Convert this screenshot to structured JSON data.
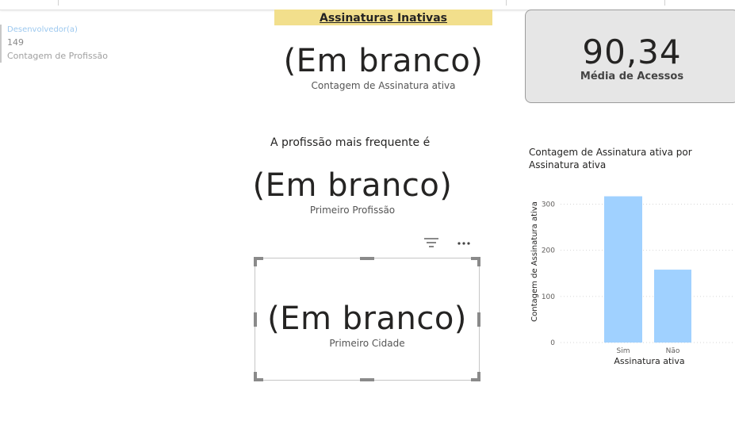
{
  "multirow_card": {
    "title": "Desenvolvedor(a)",
    "value": "149",
    "label": "Contagem de Profissão"
  },
  "banner": {
    "title": "Assinaturas Inativas"
  },
  "card_top": {
    "value": "(Em branco)",
    "caption": "Contagem de Assinatura ativa"
  },
  "kpi": {
    "value": "90,34",
    "caption": "Média de Acessos"
  },
  "headline": "A profissão mais frequente é",
  "card_middle": {
    "value": "(Em branco)",
    "caption": "Primeiro Profissão"
  },
  "card_selected": {
    "value": "(Em branco)",
    "caption": "Primeiro Cidade"
  },
  "visual_header": {
    "filter_icon": "filter-icon",
    "more_icon": "more-options-icon"
  },
  "chart_data": {
    "type": "bar",
    "title": "Contagem de Assinatura ativa por Assinatura ativa",
    "title_lines": [
      "Contagem de Assinatura ativa por",
      "Assinatura ativa"
    ],
    "xlabel": "Assinatura ativa",
    "ylabel": "Contagem de Assinatura ativa",
    "categories": [
      "Sim",
      "Não"
    ],
    "values": [
      317,
      158
    ],
    "ylim": [
      0,
      330
    ],
    "yticks": [
      0,
      100,
      200,
      300
    ],
    "grid": true,
    "bar_color": "#a0d1ff"
  }
}
